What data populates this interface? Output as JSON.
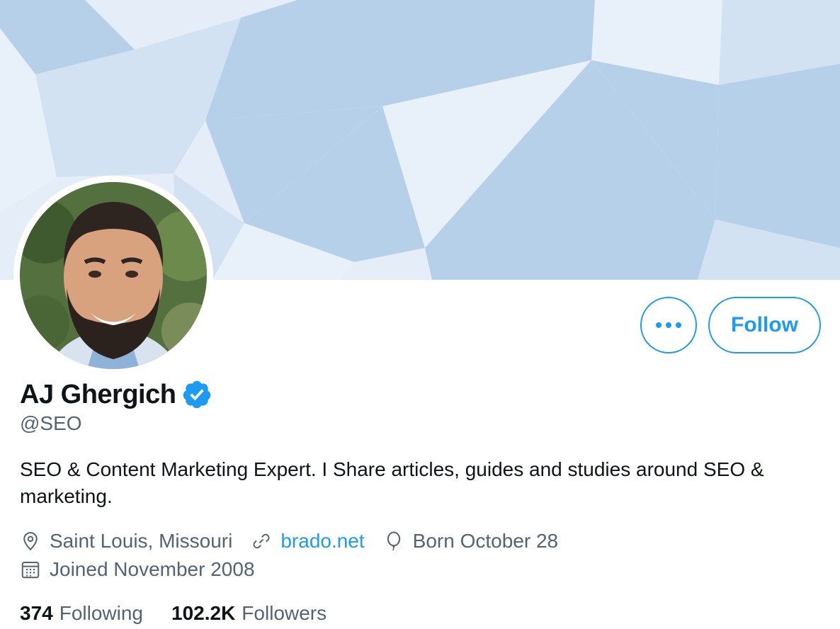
{
  "profile": {
    "display_name": "AJ Ghergich",
    "handle": "@SEO",
    "bio": "SEO & Content Marketing Expert. I Share articles, guides and studies around SEO & marketing.",
    "verified": true
  },
  "actions": {
    "more_icon": "ellipsis-icon",
    "follow_label": "Follow"
  },
  "meta": {
    "location": "Saint Louis, Missouri",
    "website": "brado.net",
    "birthday": "Born October 28",
    "joined": "Joined November 2008"
  },
  "stats": {
    "following_count": "374",
    "following_label": "Following",
    "followers_count": "102.2K",
    "followers_label": "Followers"
  },
  "colors": {
    "accent": "#1d9bf0",
    "secondary_text": "#536471",
    "primary_text": "#0f1419",
    "banner_light": "#e4edf8",
    "banner_dark": "#b7d0ea"
  },
  "icons": {
    "location": "location-pin-icon",
    "website": "link-icon",
    "birthday": "balloon-icon",
    "joined": "calendar-icon",
    "verified": "verified-badge-icon"
  }
}
